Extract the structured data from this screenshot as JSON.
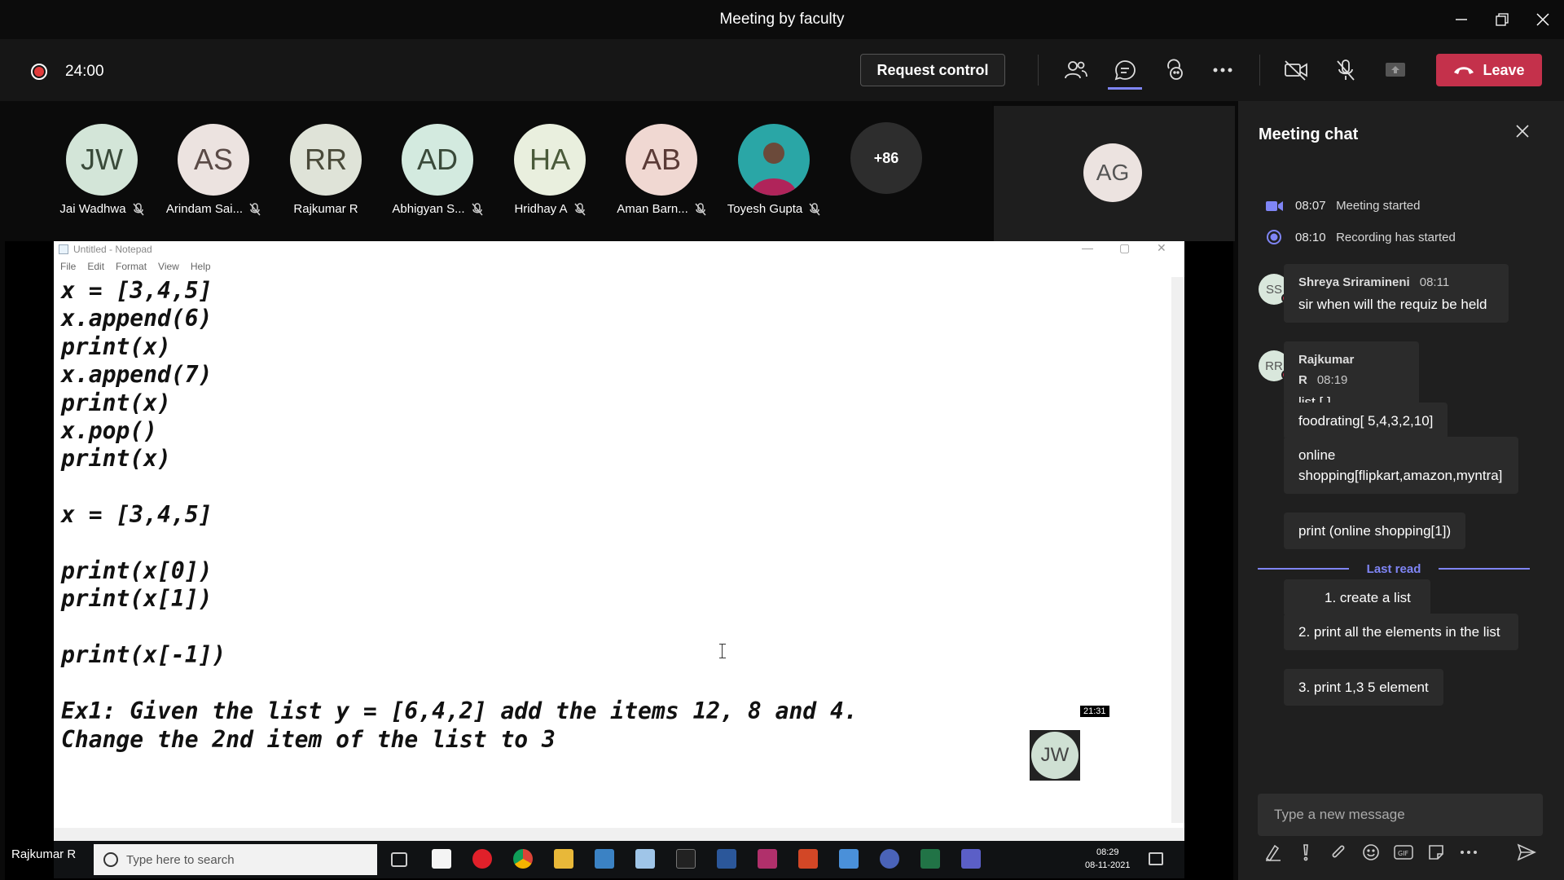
{
  "window": {
    "title": "Meeting by faculty"
  },
  "toolbar": {
    "timer": "24:00",
    "request_control": "Request control",
    "leave": "Leave"
  },
  "participants": [
    {
      "initials": "JW",
      "name": "Jai Wadhwa",
      "bg": "#d3e5d8"
    },
    {
      "initials": "AS",
      "name": "Arindam Sai...",
      "bg": "#ece3e0"
    },
    {
      "initials": "RR",
      "name": "Rajkumar R",
      "bg": "#dfe3d8"
    },
    {
      "initials": "AD",
      "name": "Abhigyan S...",
      "bg": "#d3eadf"
    },
    {
      "initials": "HA",
      "name": "Hridhay A",
      "bg": "#e9efde"
    },
    {
      "initials": "AB",
      "name": "Aman Barn...",
      "bg": "#f0d8d2"
    },
    {
      "initials": "",
      "name": "Toyesh Gupta",
      "bg": "#2aa6a6"
    }
  ],
  "more_count": "+86",
  "spotlight_initials": "AG",
  "notepad": {
    "title": "Untitled - Notepad",
    "menu": [
      "File",
      "Edit",
      "Format",
      "View",
      "Help"
    ],
    "code": "x = [3,4,5]\nx.append(6)\nprint(x)\nx.append(7)\nprint(x)\nx.pop()\nprint(x)\n\nx = [3,4,5]\n\nprint(x[0])\nprint(x[1])\n\nprint(x[-1])\n\nEx1: Given the list y = [6,4,2] add the items 12, 8 and 4.\nChange the 2nd item of the list to 3"
  },
  "mini_video": {
    "time": "21:31",
    "initials": "JW"
  },
  "presenter_tag": "Rajkumar R",
  "taskbar": {
    "search_placeholder": "Type here to search",
    "time": "08:29",
    "date": "08-11-2021"
  },
  "chat": {
    "header": "Meeting chat",
    "system": [
      {
        "time": "08:07",
        "text": "Meeting started"
      },
      {
        "time": "08:10",
        "text": "Recording has started"
      }
    ],
    "msg1": {
      "initials": "SS",
      "name": "Shreya Sriramineni",
      "time": "08:11",
      "text": "sir when will the requiz be held"
    },
    "msg2": {
      "initials": "RR",
      "name": "Rajkumar R",
      "time": "08:19",
      "text": "list [ ]"
    },
    "follow_ups": [
      "foodrating[ 5,4,3,2,10]",
      "online shopping[flipkart,amazon,myntra]",
      "print (online shopping[1])"
    ],
    "last_read": "Last read",
    "after": [
      "1. create a list",
      "2. print all the elements in the list",
      "3. print 1,3 5 element"
    ],
    "compose_placeholder": "Type a new message"
  },
  "colors": {
    "leave": "#c4314b",
    "accent": "#7f85f5"
  }
}
